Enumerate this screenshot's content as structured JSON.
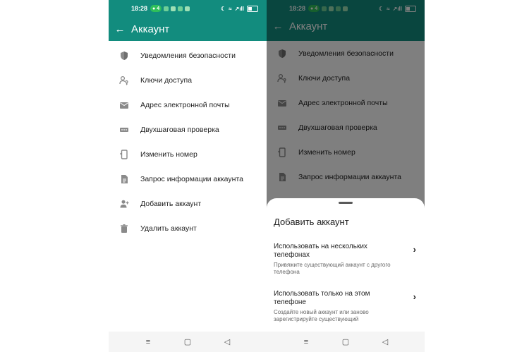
{
  "colors": {
    "header_green": "#128C7E",
    "header_dark_green": "#0a4b41",
    "icon_gray": "#8a8a8a",
    "dim_overlay": "rgba(0,0,0,0.5)"
  },
  "status_bar": {
    "time": "18:28",
    "notif_count": "4",
    "signal": "↗ıll",
    "moon_icon": "moon-icon",
    "wifi_icon": "wifi-icon",
    "battery_icon": "battery-icon"
  },
  "header": {
    "title": "Аккаунт",
    "back_icon": "arrow-left-icon"
  },
  "menu_items": [
    {
      "label": "Уведомления безопасности",
      "icon": "shield-icon"
    },
    {
      "label": "Ключи доступа",
      "icon": "person-key-icon"
    },
    {
      "label": "Адрес электронной почты",
      "icon": "email-icon"
    },
    {
      "label": "Двухшаговая проверка",
      "icon": "password-dots-icon"
    },
    {
      "label": "Изменить номер",
      "icon": "phone-change-icon"
    },
    {
      "label": "Запрос информации аккаунта",
      "icon": "document-icon"
    },
    {
      "label": "Добавить аккаунт",
      "icon": "add-person-icon"
    },
    {
      "label": "Удалить аккаунт",
      "icon": "trash-icon"
    }
  ],
  "bottom_sheet": {
    "title": "Добавить аккаунт",
    "options": [
      {
        "title": "Использовать на нескольких телефонах",
        "subtitle": "Привяжите существующий аккаунт с другого телефона",
        "chevron": "›"
      },
      {
        "title": "Использовать только на этом телефоне",
        "subtitle": "Создайте новый аккаунт или заново зарегистрируйте существующий",
        "chevron": "›"
      }
    ]
  },
  "nav_bar": {
    "menu": "≡",
    "home": "▢",
    "back": "◁"
  }
}
